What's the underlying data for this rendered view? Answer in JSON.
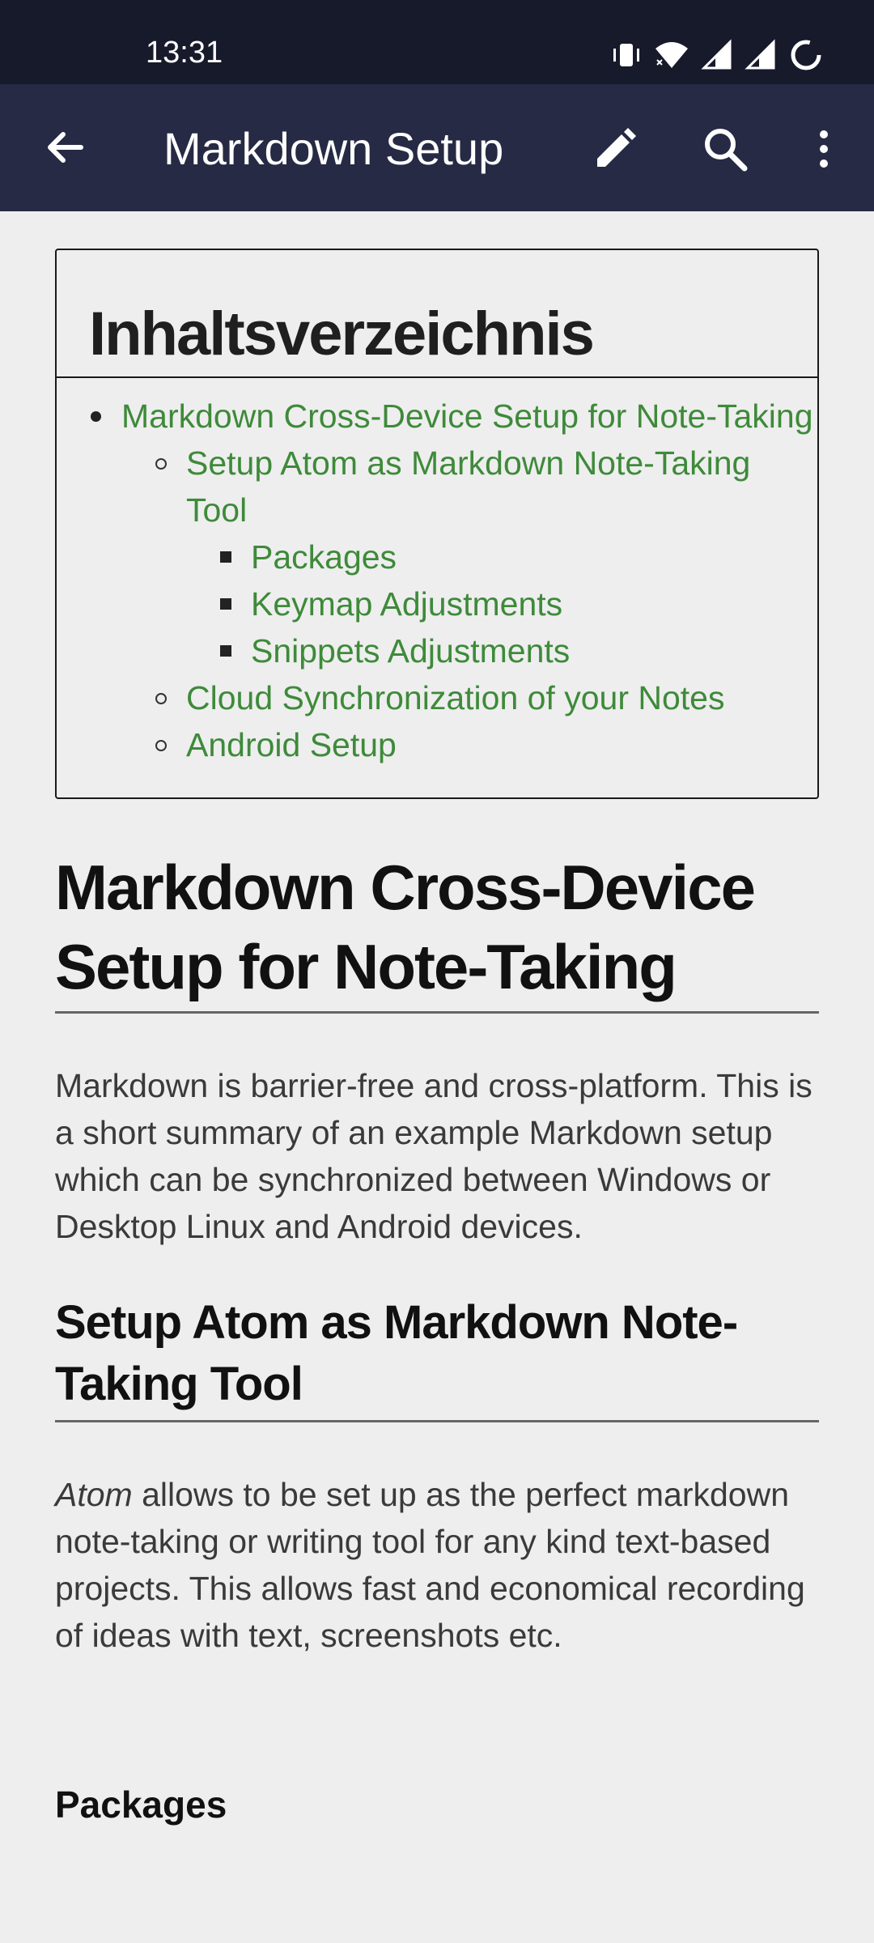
{
  "status_bar": {
    "time": "13:31",
    "icons": [
      "vibrate-icon",
      "wifi-icon",
      "signal-icon",
      "signal-icon",
      "battery-saver-icon"
    ]
  },
  "app_bar": {
    "title": "Markdown Setup",
    "back_icon": "arrow-back-icon",
    "edit_icon": "pencil-icon",
    "search_icon": "search-icon",
    "more_icon": "more-vert-icon",
    "background": "#262a44"
  },
  "toc": {
    "title": "Inhaltsverzeichnis",
    "items": [
      {
        "label": "Markdown Cross-Device Setup for Note-Taking",
        "children": [
          {
            "label": "Setup Atom as Markdown Note-Taking Tool",
            "children": [
              {
                "label": "Packages"
              },
              {
                "label": "Keymap Adjustments"
              },
              {
                "label": "Snippets Adjustments"
              }
            ]
          },
          {
            "label": "Cloud Synchronization of your Notes"
          },
          {
            "label": "Android Setup"
          }
        ]
      }
    ],
    "link_color": "#3e8a3a"
  },
  "article": {
    "h1": "Markdown Cross-Device Setup for Note-Taking",
    "intro": "Markdown is barrier-free and cross-platform. This is a short summary of an example Markdown setup which can be synchronized between Windows or Desktop Linux and Android devices.",
    "h2": "Setup Atom as Markdown Note-Taking Tool",
    "atom_em": "Atom",
    "atom_text": " allows to be set up as the perfect markdown note-taking or writing tool for any kind text-based projects. This allows fast and economical recording of ideas with text, screenshots etc.",
    "h3": "Packages"
  }
}
